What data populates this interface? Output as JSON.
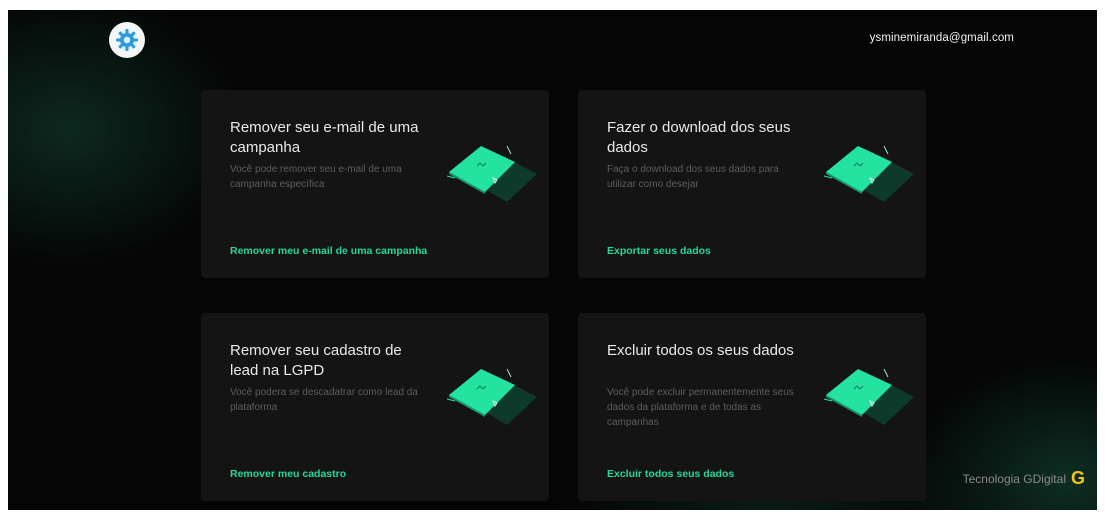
{
  "header": {
    "logo_icon": "gear-icon",
    "user_email": "ysminemiranda@gmail.com"
  },
  "cards": [
    {
      "title": "Remover seu e-mail de uma campanha",
      "description": "Você pode remover seu e-mail de uma campanha específica",
      "action_label": "Remover meu e-mail de uma campanha",
      "illustration": "document-illustration"
    },
    {
      "title": "Fazer o download dos seus dados",
      "description": "Faça o download dos seus dados para utilizar como desejar",
      "action_label": "Exportar seus dados",
      "illustration": "document-illustration"
    },
    {
      "title": "Remover seu cadastro de lead na LGPD",
      "description": "Você podera se descadatrar como lead da plataforma",
      "action_label": "Remover meu cadastro",
      "illustration": "document-illustration"
    },
    {
      "title": "Excluir todos os seus dados",
      "description": "Você pode excluir permanentemente seus dados da plataforma e de todas as campanhas",
      "action_label": "Excluir todos seus dados",
      "illustration": "document-illustration"
    }
  ],
  "footer": {
    "brand_text": "Tecnologia GDigital",
    "brand_mark": "G"
  },
  "colors": {
    "accent": "#23d99a",
    "background": "#050505",
    "card": "#141414",
    "brand_yellow": "#f5c518"
  }
}
